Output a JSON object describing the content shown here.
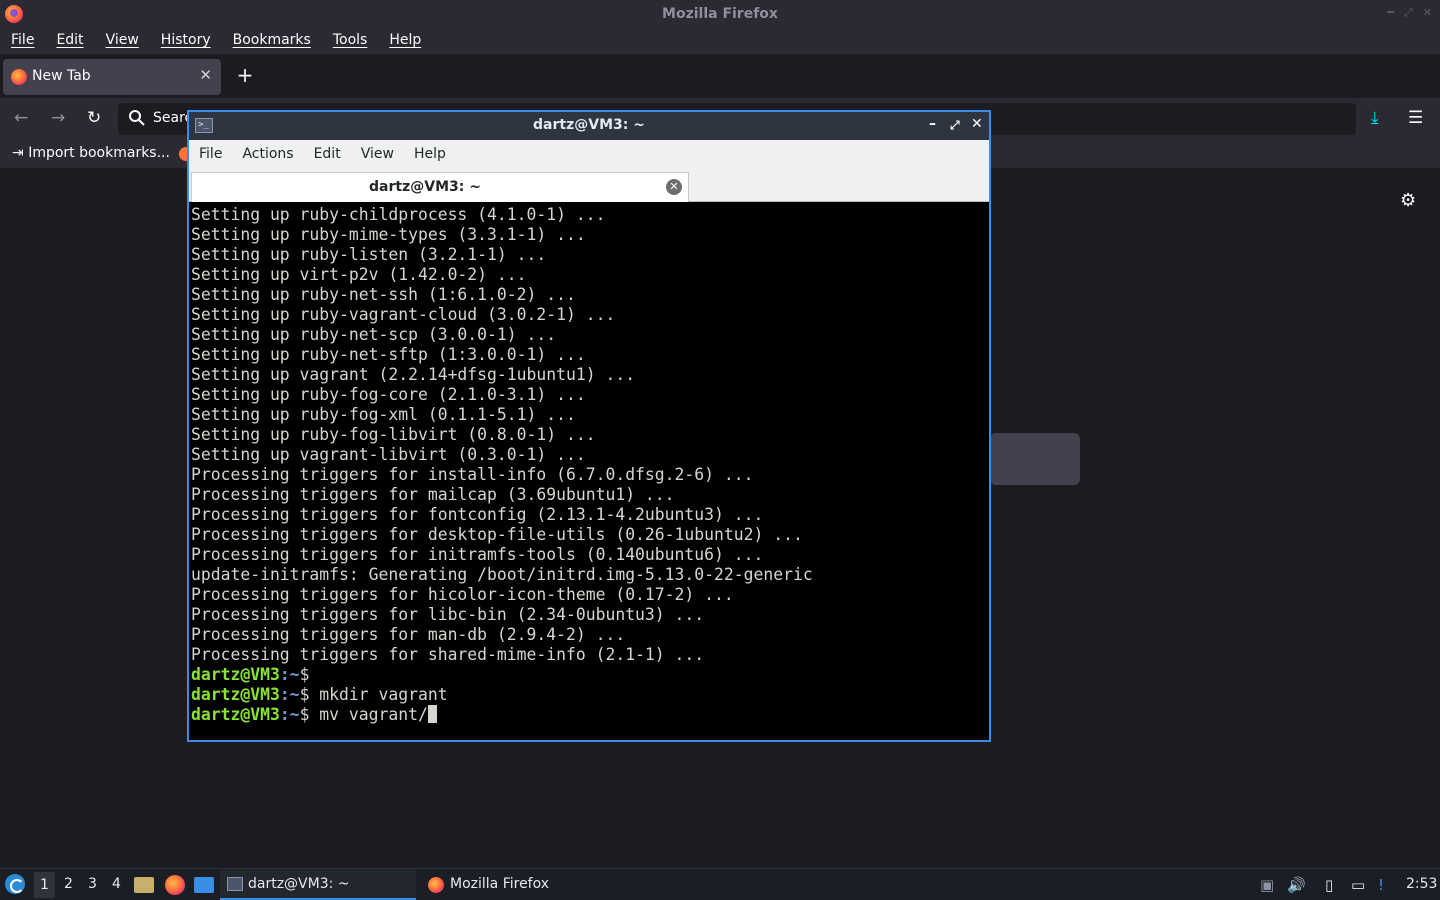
{
  "firefox": {
    "window_title": "Mozilla Firefox",
    "menu": [
      "File",
      "Edit",
      "View",
      "History",
      "Bookmarks",
      "Tools",
      "Help"
    ],
    "tab": {
      "label": "New Tab",
      "close": "✕"
    },
    "new_tab": "+",
    "search_placeholder": "Search",
    "bookmarks": {
      "import_label": "Import bookmarks..."
    }
  },
  "terminal": {
    "title": "dartz@VM3: ~",
    "menu": [
      "File",
      "Actions",
      "Edit",
      "View",
      "Help"
    ],
    "tab_label": "dartz@VM3: ~",
    "output": [
      "Setting up ruby-childprocess (4.1.0-1) ...",
      "Setting up ruby-mime-types (3.3.1-1) ...",
      "Setting up ruby-listen (3.2.1-1) ...",
      "Setting up virt-p2v (1.42.0-2) ...",
      "Setting up ruby-net-ssh (1:6.1.0-2) ...",
      "Setting up ruby-vagrant-cloud (3.0.2-1) ...",
      "Setting up ruby-net-scp (3.0.0-1) ...",
      "Setting up ruby-net-sftp (1:3.0.0-1) ...",
      "Setting up vagrant (2.2.14+dfsg-1ubuntu1) ...",
      "Setting up ruby-fog-core (2.1.0-3.1) ...",
      "Setting up ruby-fog-xml (0.1.1-5.1) ...",
      "Setting up ruby-fog-libvirt (0.8.0-1) ...",
      "Setting up vagrant-libvirt (0.3.0-1) ...",
      "Processing triggers for install-info (6.7.0.dfsg.2-6) ...",
      "Processing triggers for mailcap (3.69ubuntu1) ...",
      "Processing triggers for fontconfig (2.13.1-4.2ubuntu3) ...",
      "Processing triggers for desktop-file-utils (0.26-1ubuntu2) ...",
      "Processing triggers for initramfs-tools (0.140ubuntu6) ...",
      "update-initramfs: Generating /boot/initrd.img-5.13.0-22-generic",
      "Processing triggers for hicolor-icon-theme (0.17-2) ...",
      "Processing triggers for libc-bin (2.34-0ubuntu3) ...",
      "Processing triggers for man-db (2.9.4-2) ...",
      "Processing triggers for shared-mime-info (2.1-1) ..."
    ],
    "prompt_user": "dartz@VM3",
    "prompt_path": ":~",
    "prompt_symbol": "$",
    "commands": [
      "",
      " mkdir vagrant",
      " mv vagrant/"
    ]
  },
  "taskbar": {
    "workspaces": [
      "1",
      "2",
      "3",
      "4"
    ],
    "tasks": [
      "dartz@VM3: ~",
      "Mozilla Firefox"
    ],
    "clock": "2:53"
  }
}
